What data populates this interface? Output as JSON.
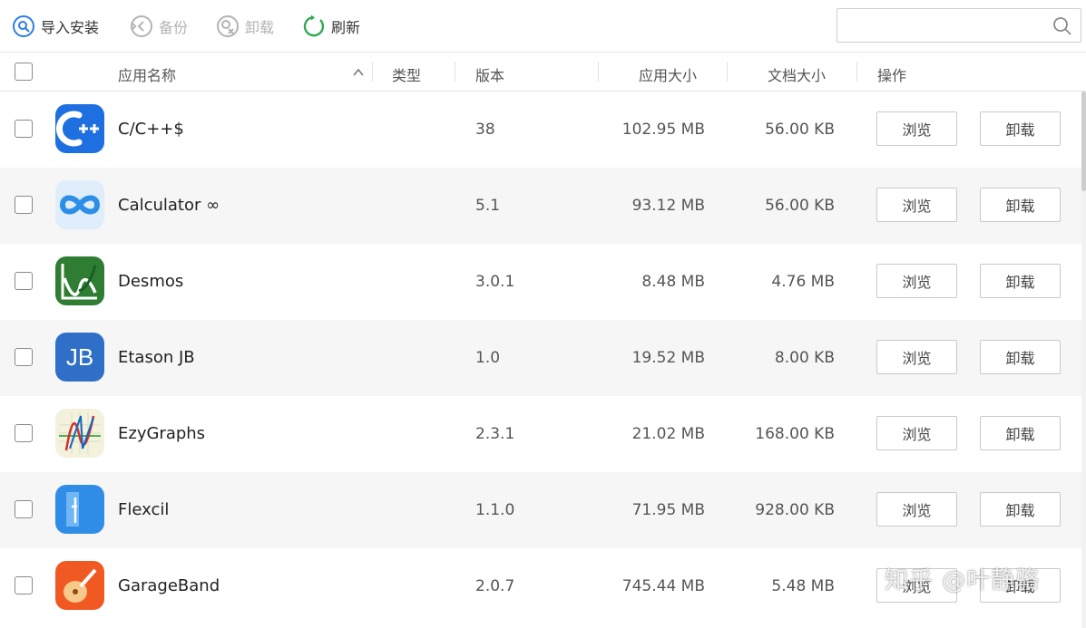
{
  "toolbar": {
    "import_install": "导入安装",
    "backup": "备份",
    "uninstall": "卸载",
    "refresh": "刷新",
    "search_placeholder": ""
  },
  "table": {
    "headers": {
      "name": "应用名称",
      "type": "类型",
      "version": "版本",
      "app_size": "应用大小",
      "doc_size": "文档大小",
      "actions": "操作"
    },
    "browse_label": "浏览",
    "uninstall_label": "卸载",
    "rows": [
      {
        "name": "C/C++$",
        "version": "38",
        "app_size": "102.95 MB",
        "doc_size": "56.00 KB",
        "icon": "cpp-app-icon"
      },
      {
        "name": "Calculator ∞",
        "version": "5.1",
        "app_size": "93.12 MB",
        "doc_size": "56.00 KB",
        "icon": "calculator-infinity-app-icon"
      },
      {
        "name": "Desmos",
        "version": "3.0.1",
        "app_size": "8.48 MB",
        "doc_size": "4.76 MB",
        "icon": "desmos-app-icon"
      },
      {
        "name": "Etason JB",
        "version": "1.0",
        "app_size": "19.52 MB",
        "doc_size": "8.00 KB",
        "icon": "etason-jb-app-icon"
      },
      {
        "name": "EzyGraphs",
        "version": "2.3.1",
        "app_size": "21.02 MB",
        "doc_size": "168.00 KB",
        "icon": "ezygraphs-app-icon"
      },
      {
        "name": "Flexcil",
        "version": "1.1.0",
        "app_size": "71.95 MB",
        "doc_size": "928.00 KB",
        "icon": "flexcil-app-icon"
      },
      {
        "name": "GarageBand",
        "version": "2.0.7",
        "app_size": "745.44 MB",
        "doc_size": "5.48 MB",
        "icon": "garageband-app-icon"
      }
    ]
  },
  "watermark": "知乎 @叶静骆",
  "colors": {
    "accent_blue": "#2b7de0",
    "refresh_green": "#2fa84f",
    "disabled_gray": "#b3b3b3",
    "row_alt": "#f6f6f6"
  }
}
